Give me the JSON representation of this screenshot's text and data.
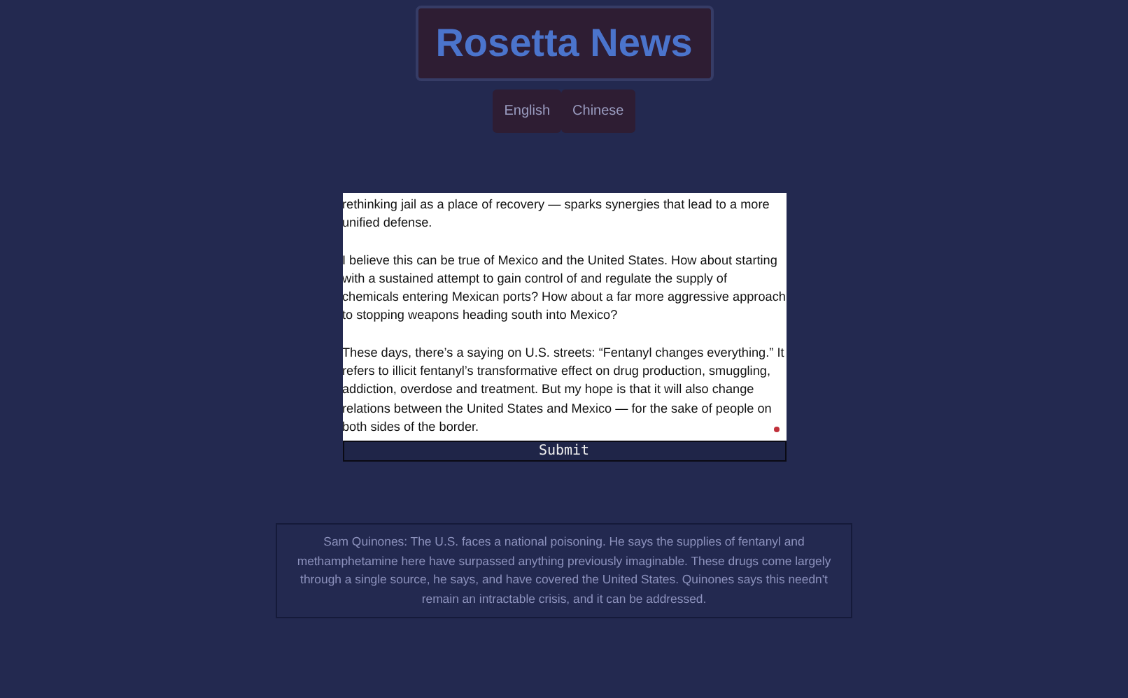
{
  "header": {
    "title": "Rosetta News"
  },
  "languages": [
    {
      "label": "English"
    },
    {
      "label": "Chinese"
    }
  ],
  "editor": {
    "paragraphs": [
      "rethinking jail as a place of recovery — sparks synergies that lead to a more unified defense.",
      "I believe this can be true of Mexico and the United States. How about starting with a sustained attempt to gain control of and regulate the supply of chemicals entering Mexican ports? How about a far more aggressive approach to stopping weapons heading south into Mexico?",
      "These days, there’s a saying on U.S. streets: “Fentanyl changes everything.” It refers to illicit fentanyl’s transformative effect on drug production, smuggling, addiction, overdose and treatment. But my hope is that it will also change relations between the United States and Mexico — for the sake of people on both sides of the border."
    ],
    "submit": "Submit"
  },
  "summary": "Sam Quinones: The U.S. faces a national poisoning. He says the supplies of fentanyl and methamphetamine here have surpassed anything previously imaginable. These drugs come largely through a single source, he says, and have covered the United States. Quinones says this needn't remain an intractable crisis, and it can be addressed."
}
